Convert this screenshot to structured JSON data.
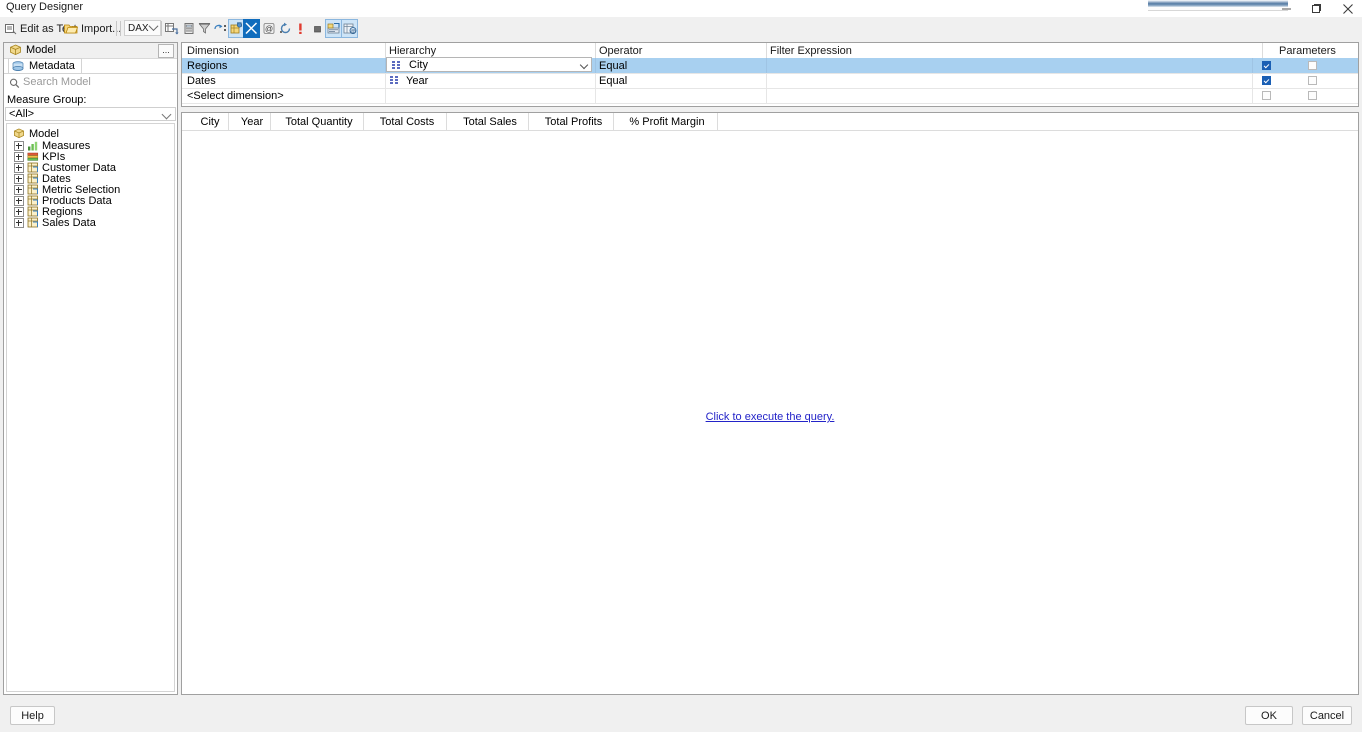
{
  "window": {
    "title": "Query Designer",
    "minimize_label": "—",
    "maximize_label": "❐",
    "close_label": "✕"
  },
  "toolbar": {
    "edit_as_text_label": "Edit as Text",
    "import_label": "Import...",
    "language_value": "DAX",
    "icons": [
      "add-calculated-member-icon",
      "delete-icon",
      "filter-icon",
      "auto-execute-icon",
      "show-aggregations-icon",
      "delete-query-icon",
      "at-icon",
      "refresh-icon",
      "exclamation-icon",
      "stop-icon",
      "design-mode-icon",
      "query-parameters-icon"
    ]
  },
  "left_panel": {
    "header_title": "Model",
    "more_label": "...",
    "tab_label": "Metadata",
    "search_placeholder": "Search Model",
    "measure_group_label": "Measure Group:",
    "measure_group_value": "<All>",
    "tree": {
      "root_label": "Model",
      "items": [
        {
          "label": "Measures",
          "icon": "measures-icon"
        },
        {
          "label": "KPIs",
          "icon": "kpi-icon"
        },
        {
          "label": "Customer Data",
          "icon": "table-icon"
        },
        {
          "label": "Dates",
          "icon": "table-icon"
        },
        {
          "label": "Metric Selection",
          "icon": "table-icon"
        },
        {
          "label": "Products Data",
          "icon": "table-icon"
        },
        {
          "label": "Regions",
          "icon": "table-icon"
        },
        {
          "label": "Sales Data",
          "icon": "table-icon"
        }
      ]
    }
  },
  "filter_grid": {
    "columns": [
      "Dimension",
      "Hierarchy",
      "Operator",
      "Filter Expression",
      "Parameters"
    ],
    "rows": [
      {
        "dimension": "Regions",
        "hierarchy": "City",
        "operator": "Equal",
        "filter_expression": "",
        "parameter_checked": true,
        "second_checked": false,
        "selected": true
      },
      {
        "dimension": "Dates",
        "hierarchy": "Year",
        "operator": "Equal",
        "filter_expression": "",
        "parameter_checked": true,
        "second_checked": false,
        "selected": false
      },
      {
        "dimension": "<Select dimension>",
        "hierarchy": "",
        "operator": "",
        "filter_expression": "",
        "parameter_checked": false,
        "second_checked": false,
        "selected": false
      }
    ]
  },
  "result_grid": {
    "columns": [
      "City",
      "Year",
      "Total Quantity",
      "Total Costs",
      "Total Sales",
      "Total Profits",
      "% Profit Margin"
    ],
    "execute_link": "Click to execute the query.",
    "rows": []
  },
  "footer": {
    "help_label": "Help",
    "ok_label": "OK",
    "cancel_label": "Cancel"
  },
  "colors": {
    "selection_blue": "#a8d0f0",
    "highlight_blue": "#0f6cbd",
    "link_blue": "#2323c8",
    "checkbox_blue": "#1a5fb4"
  }
}
